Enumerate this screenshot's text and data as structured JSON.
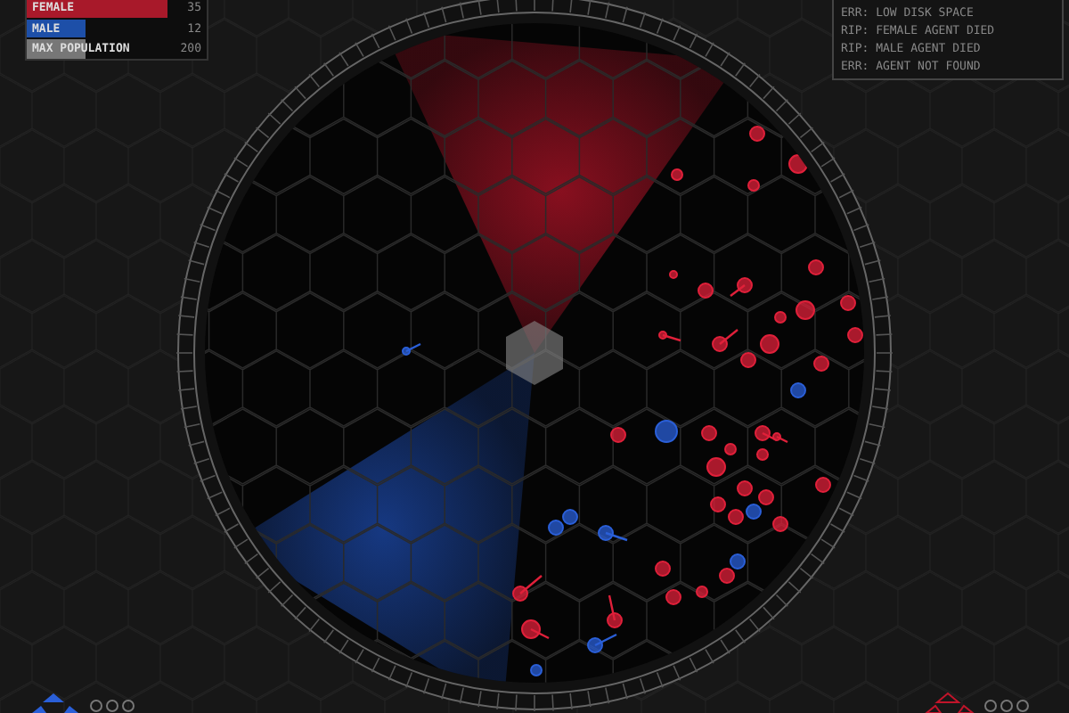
{
  "stats": [
    {
      "kind": "female",
      "label": "FEMALE",
      "value": "35",
      "level": 0.78
    },
    {
      "kind": "male",
      "label": "MALE",
      "value": "12",
      "level": 0.33
    },
    {
      "kind": "max",
      "label": "MAX POPULATION",
      "value": "200",
      "level": 0.33
    }
  ],
  "log": [
    "ERR: LOW DISK SPACE",
    "RIP: FEMALE AGENT DIED",
    "RIP: MALE AGENT DIED",
    "ERR: AGENT NOT FOUND"
  ]
}
